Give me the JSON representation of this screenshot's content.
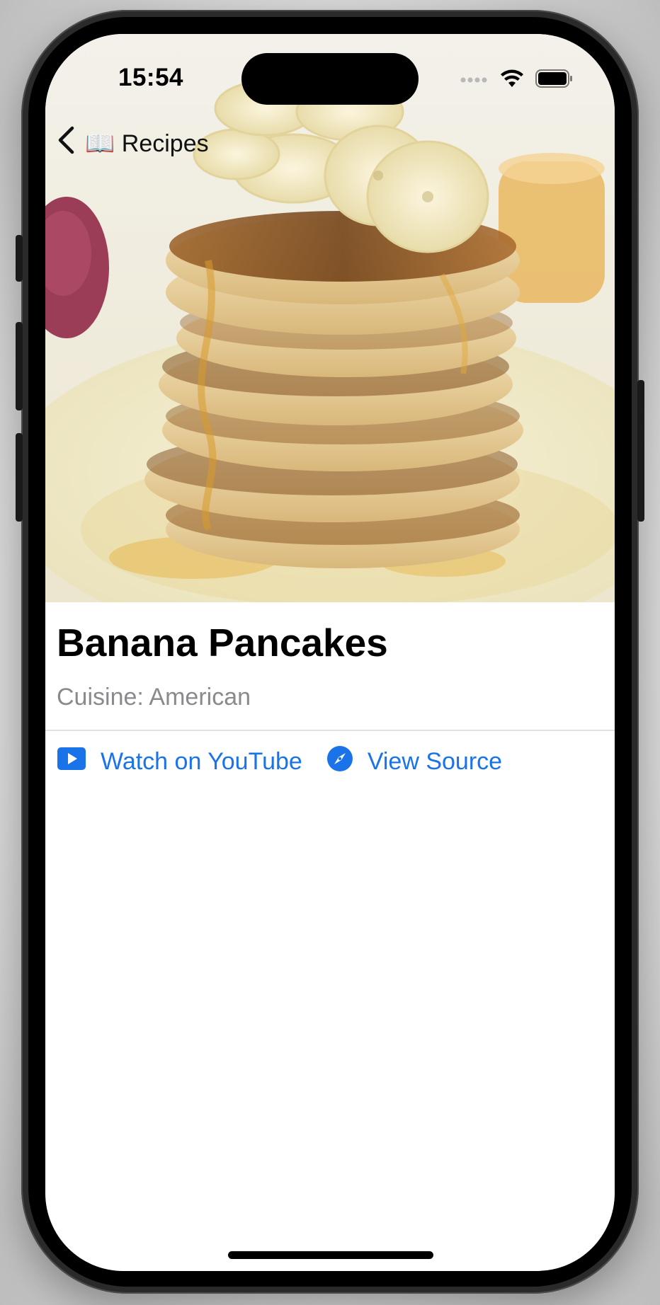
{
  "status_bar": {
    "time": "15:54"
  },
  "nav": {
    "back_label": "📖 Recipes",
    "back_icon": "chevron-left-icon"
  },
  "recipe": {
    "title": "Banana Pancakes",
    "cuisine_line": "Cuisine: American"
  },
  "links": {
    "youtube_label": "Watch on YouTube",
    "youtube_icon": "play-rectangle-icon",
    "source_label": "View Source",
    "source_icon": "safari-compass-icon"
  },
  "colors": {
    "accent": "#1a73e8",
    "secondary_text": "#8a8a8e",
    "title_text": "#000000"
  }
}
